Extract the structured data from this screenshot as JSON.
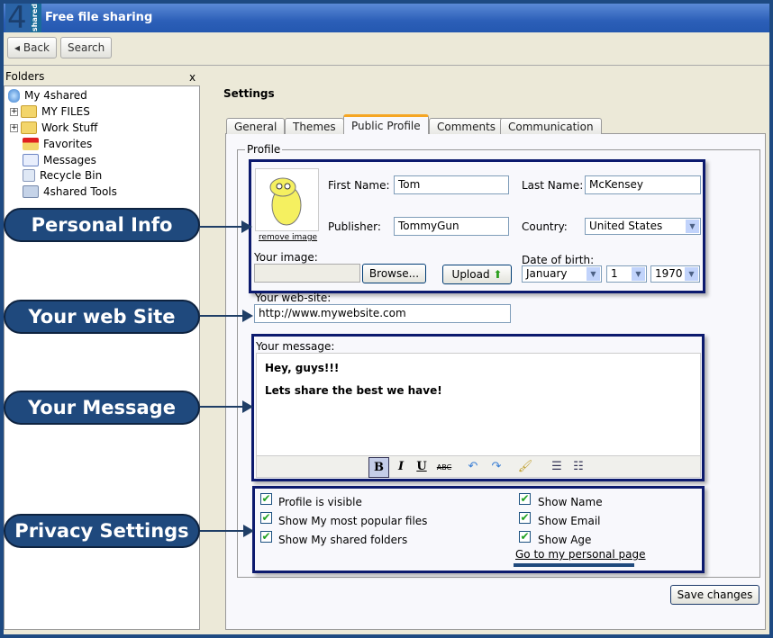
{
  "window": {
    "title": "Free file sharing",
    "logo_number": "4",
    "logo_text": "shared"
  },
  "toolbar": {
    "back_label": "Back",
    "search_label": "Search"
  },
  "sidebar": {
    "header": "Folders",
    "close": "x",
    "items": [
      {
        "label": "My 4shared",
        "icon": "drive-icon"
      },
      {
        "label": "MY FILES",
        "icon": "folder-icon"
      },
      {
        "label": "Work Stuff",
        "icon": "folder-icon"
      },
      {
        "label": "Favorites",
        "icon": "favorites-icon"
      },
      {
        "label": "Messages",
        "icon": "messages-icon"
      },
      {
        "label": "Recycle Bin",
        "icon": "recycle-bin-icon"
      },
      {
        "label": "4shared Tools",
        "icon": "tools-icon"
      }
    ]
  },
  "settings": {
    "title": "Settings",
    "tabs": [
      "General",
      "Themes",
      "Public Profile",
      "Comments",
      "Communication"
    ],
    "active_tab": "Public Profile"
  },
  "profile": {
    "legend": "Profile",
    "remove_image": "remove image",
    "first_name_label": "First Name:",
    "first_name": "Tom",
    "last_name_label": "Last Name:",
    "last_name": "McKensey",
    "publisher_label": "Publisher:",
    "publisher": "TommyGun",
    "country_label": "Country:",
    "country": "United States",
    "your_image_label": "Your image:",
    "browse_label": "Browse...",
    "upload_label": "Upload",
    "dob_label": "Date of birth:",
    "dob_month": "January",
    "dob_day": "1",
    "dob_year": "1970",
    "website_label": "Your web-site:",
    "website": "http://www.mywebsite.com",
    "message_label": "Your message:",
    "message_line1": "Hey, guys!!!",
    "message_line2": "Lets share the best we have!"
  },
  "editor_tools": {
    "bold": "B",
    "italic": "I",
    "underline": "U",
    "strike": "ABC"
  },
  "privacy": {
    "left": [
      "Profile is visible",
      "Show My most popular files",
      "Show My shared folders"
    ],
    "right": [
      "Show Name",
      "Show Email",
      "Show Age"
    ],
    "personal_page_link": "Go to my personal page"
  },
  "save_label": "Save changes",
  "callouts": [
    "Personal Info",
    "Your web Site",
    "Your Message",
    "Privacy Settings"
  ],
  "colors": {
    "callout": "#1f497d",
    "highlight_border": "#0c1a6e",
    "title_bar": "#2c5fb8"
  }
}
